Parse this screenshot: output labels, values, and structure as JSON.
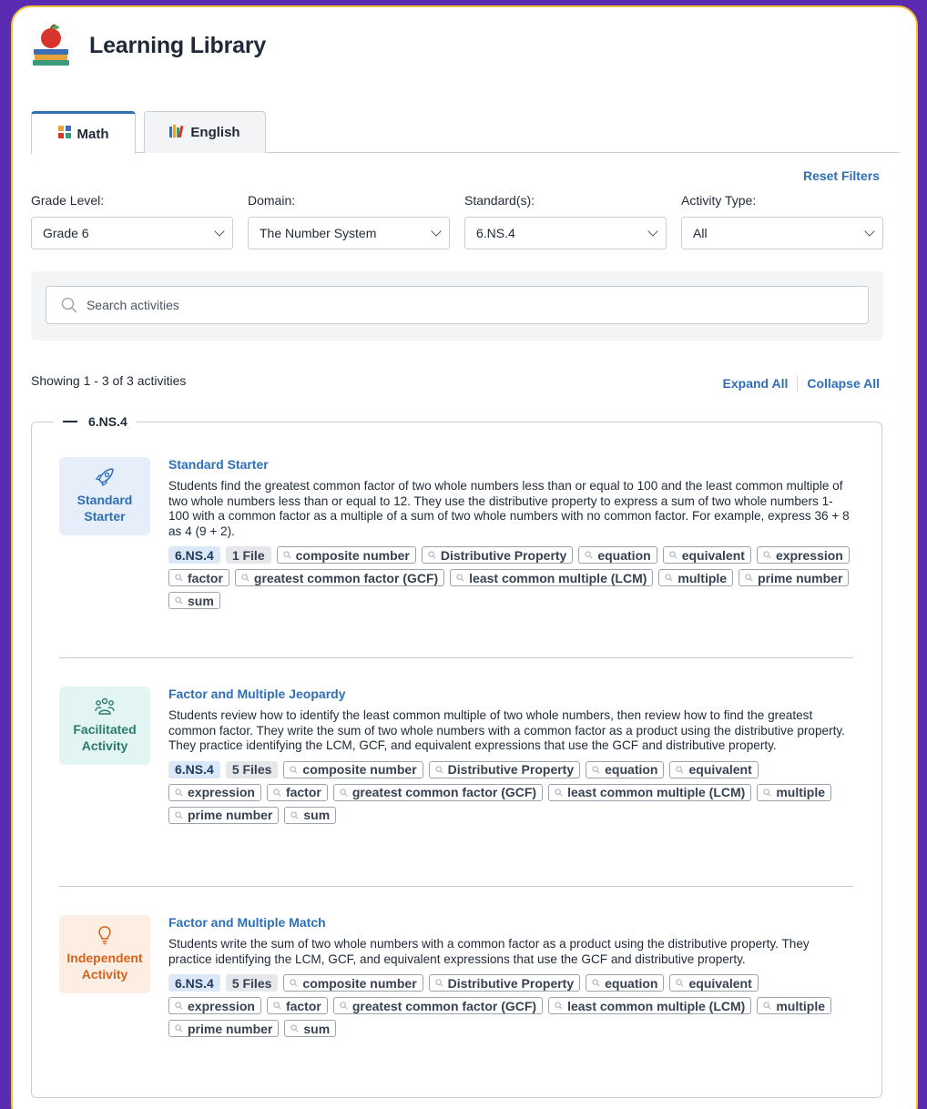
{
  "app": {
    "title": "Learning Library"
  },
  "tabs": [
    {
      "label": "Math",
      "active": true,
      "icon": "grid-blocks-icon"
    },
    {
      "label": "English",
      "active": false,
      "icon": "books-icon"
    }
  ],
  "filters": {
    "reset_label": "Reset Filters",
    "grade": {
      "label": "Grade Level:",
      "value": "Grade 6"
    },
    "domain": {
      "label": "Domain:",
      "value": "The Number System"
    },
    "standard": {
      "label": "Standard(s):",
      "value": "6.NS.4"
    },
    "activity_type": {
      "label": "Activity Type:",
      "value": "All"
    }
  },
  "search": {
    "placeholder": "Search activities",
    "value": ""
  },
  "results": {
    "showing": "Showing 1 - 3 of 3 activities",
    "expand_all": "Expand All",
    "collapse_all": "Collapse All"
  },
  "group": {
    "label": "6.NS.4",
    "activities": [
      {
        "type_line1": "Standard",
        "type_line2": "Starter",
        "icon": "rocket-icon",
        "title": "Standard Starter",
        "description": "Students find the greatest common factor of two whole numbers less than or equal to 100 and the least common multiple of two whole numbers less than or equal to 12. They use the distributive property to express a sum of two whole numbers 1-100 with a common factor as a multiple of a sum of two whole numbers with no common factor. For example, express 36 + 8 as 4 (9 + 2).",
        "standard": "6.NS.4",
        "files": "1 File",
        "tags": [
          "composite number",
          "Distributive Property",
          "equation",
          "equivalent",
          "expression",
          "factor",
          "greatest common factor (GCF)",
          "least common multiple (LCM)",
          "multiple",
          "prime number",
          "sum"
        ]
      },
      {
        "type_line1": "Facilitated",
        "type_line2": "Activity",
        "icon": "people-group-icon",
        "title": "Factor and Multiple Jeopardy",
        "description": "Students review how to identify the least common multiple of two whole numbers, then review how to find the greatest common factor. They write the sum of two whole numbers with a common factor as a product using the distributive property. They practice identifying the LCM, GCF, and equivalent expressions that use the GCF and distributive property.",
        "standard": "6.NS.4",
        "files": "5 Files",
        "tags": [
          "composite number",
          "Distributive Property",
          "equation",
          "equivalent",
          "expression",
          "factor",
          "greatest common factor (GCF)",
          "least common multiple (LCM)",
          "multiple",
          "prime number",
          "sum"
        ]
      },
      {
        "type_line1": "Independent",
        "type_line2": "Activity",
        "icon": "lightbulb-icon",
        "title": "Factor and Multiple Match",
        "description": "Students write the sum of two whole numbers with a common factor as a product using the distributive property. They practice identifying the LCM, GCF, and equivalent expressions that use the GCF and distributive property.",
        "standard": "6.NS.4",
        "files": "5 Files",
        "tags": [
          "composite number",
          "Distributive Property",
          "equation",
          "equivalent",
          "expression",
          "factor",
          "greatest common factor (GCF)",
          "least common multiple (LCM)",
          "multiple",
          "prime number",
          "sum"
        ]
      }
    ]
  },
  "colors": {
    "background": "#5a2bb0",
    "card_border": "#f1c232",
    "link": "#2e6fb7",
    "starter_bg": "#e6eefa",
    "starter_fg": "#2e6fb7",
    "facilitated_bg": "#e3f5f3",
    "facilitated_fg": "#2b7a6e",
    "independent_bg": "#fdeee3",
    "independent_fg": "#d9621a"
  }
}
